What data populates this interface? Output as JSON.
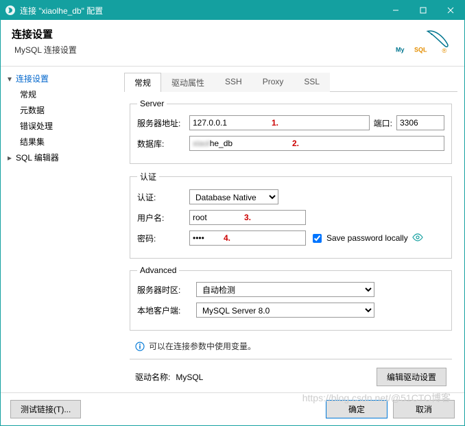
{
  "window": {
    "title": "连接 \"xiaolhe_db\" 配置"
  },
  "header": {
    "title": "连接设置",
    "subtitle": "MySQL 连接设置",
    "logo_text": "MySQL"
  },
  "sidebar": {
    "items": [
      {
        "label": "连接设置",
        "selected": true,
        "expandable": true
      },
      {
        "label": "常规",
        "child": true
      },
      {
        "label": "元数据",
        "child": true
      },
      {
        "label": "错误处理",
        "child": true
      },
      {
        "label": "结果集",
        "child": true
      },
      {
        "label": "SQL 编辑器",
        "expandable": true
      }
    ]
  },
  "tabs": [
    "常规",
    "驱动属性",
    "SSH",
    "Proxy",
    "SSL"
  ],
  "active_tab": 0,
  "server": {
    "legend": "Server",
    "host_label": "服务器地址:",
    "host_value": "127.0.0.1",
    "port_label": "端口:",
    "port_value": "3306",
    "db_label": "数据库:",
    "db_value_prefix": "xiaol",
    "db_value_suffix": "he_db"
  },
  "auth": {
    "legend": "认证",
    "auth_label": "认证:",
    "auth_value": "Database Native",
    "user_label": "用户名:",
    "user_value": "root",
    "pass_label": "密码:",
    "pass_value": "****",
    "save_label": "Save password locally"
  },
  "advanced": {
    "legend": "Advanced",
    "tz_label": "服务器时区:",
    "tz_value": "自动检测",
    "client_label": "本地客户端:",
    "client_value": "MySQL Server 8.0"
  },
  "info_text": "可以在连接参数中使用变量。",
  "driver": {
    "label": "驱动名称:",
    "name": "MySQL",
    "edit_button": "编辑驱动设置"
  },
  "footer": {
    "test": "测试链接(T)...",
    "ok": "确定",
    "cancel": "取消"
  },
  "annotations": {
    "a1": "1.",
    "a2": "2.",
    "a3": "3.",
    "a4": "4."
  },
  "watermark": "https://blog.csdn.net/@51CTO博客"
}
